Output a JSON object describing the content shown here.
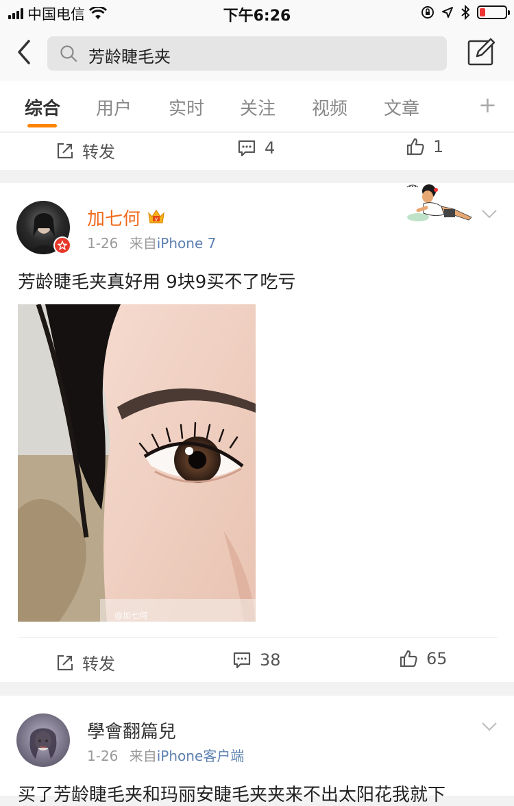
{
  "status_bar": {
    "carrier": "中国电信",
    "time": "下午6:26"
  },
  "nav": {
    "search_query": "芳龄睫毛夹"
  },
  "tabs": [
    {
      "label": "综合",
      "active": true
    },
    {
      "label": "用户",
      "active": false
    },
    {
      "label": "实时",
      "active": false
    },
    {
      "label": "关注",
      "active": false
    },
    {
      "label": "视频",
      "active": false
    },
    {
      "label": "文章",
      "active": false
    }
  ],
  "tab_plus": "+",
  "prev_post": {
    "repost_label": "转发",
    "comment_count": "4",
    "like_count": "1"
  },
  "post1": {
    "username": "加七何",
    "date": "1-26",
    "source_prefix": "来自",
    "source": "iPhone 7",
    "text": "芳龄睫毛夹真好用 9块9买不了吃亏",
    "watermark": "@加七何",
    "repost_label": "转发",
    "comment_count": "38",
    "like_count": "65"
  },
  "post2": {
    "username": "學會翻篇兒",
    "date": "1-26",
    "source_prefix": "来自",
    "source": "iPhone客户端",
    "text": "买了芳龄睫毛夹和玛丽安睫毛夹夹来不出太阳花我就下"
  },
  "colors": {
    "accent": "#ff8200",
    "username_vip": "#f16a1b",
    "source_link": "#5b7fb0",
    "verified": "#e6392b"
  }
}
